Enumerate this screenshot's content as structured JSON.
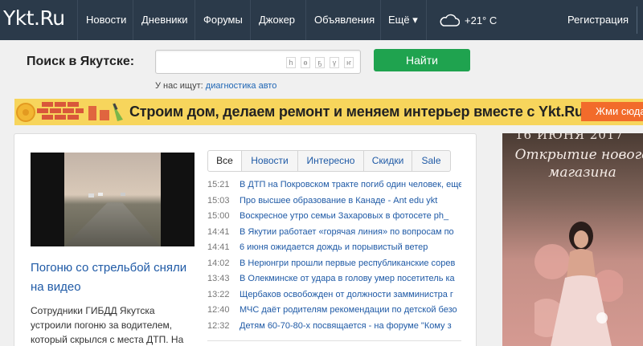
{
  "header": {
    "logo": "Ykt.Ru",
    "nav": [
      "Новости",
      "Дневники",
      "Форумы",
      "Джокер",
      "Объявления",
      "Ещё ▾"
    ],
    "weather": "+21° C",
    "register": "Регистрация"
  },
  "search": {
    "label": "Поиск в Якутске:",
    "placeholder": "",
    "letters": [
      "һ",
      "ө",
      "ҕ",
      "ү",
      "ҥ"
    ],
    "button": "Найти",
    "hint_prefix": "У нас ищут:",
    "hint_link": "диагностика авто"
  },
  "banner": {
    "text": "Строим дом, делаем ремонт и меняем интерьер вместе с Ykt.Ru",
    "button": "Жми сюда"
  },
  "feature": {
    "headline": "Погоню со стрельбой сняли на видео",
    "lead": "Сотрудники ГИБДД Якутска устроили погоню за водителем, который скрылся с места ДТП. На улице"
  },
  "tabs": [
    "Все",
    "Новости",
    "Интересно",
    "Скидки",
    "Sale"
  ],
  "news": [
    {
      "time": "15:21",
      "title": "В ДТП на Покровском тракте погиб один человек, еще"
    },
    {
      "time": "15:03",
      "title": "Про высшее образование в Канаде - Ant edu ykt"
    },
    {
      "time": "15:00",
      "title": "Воскресное утро семьи Захаровых в фотосете ph_"
    },
    {
      "time": "14:41",
      "title": "В Якутии работает «горячая линия» по вопросам по"
    },
    {
      "time": "14:41",
      "title": "6 июня ожидается дождь и порывистый ветер"
    },
    {
      "time": "14:02",
      "title": "В Нерюнгри прошли первые республиканские сорев"
    },
    {
      "time": "13:43",
      "title": "В Олекминске от удара в голову умер посетитель ка"
    },
    {
      "time": "13:22",
      "title": "Щербаков освобожден от должности замминистра г"
    },
    {
      "time": "12:40",
      "title": "МЧС даёт родителям рекомендации по детской безо"
    },
    {
      "time": "12:32",
      "title": "Детям 60-70-80-х посвящается - на форуме \"Кому з"
    }
  ],
  "ad": {
    "date": "16 ИЮНЯ 2017",
    "script": "Открытие нового магазина"
  },
  "colors": {
    "topbar": "#2b3a4a",
    "link": "#1f5aa6",
    "search_button": "#1fa34f",
    "banner": "#f7d55c",
    "banner_button": "#f26b2b"
  }
}
